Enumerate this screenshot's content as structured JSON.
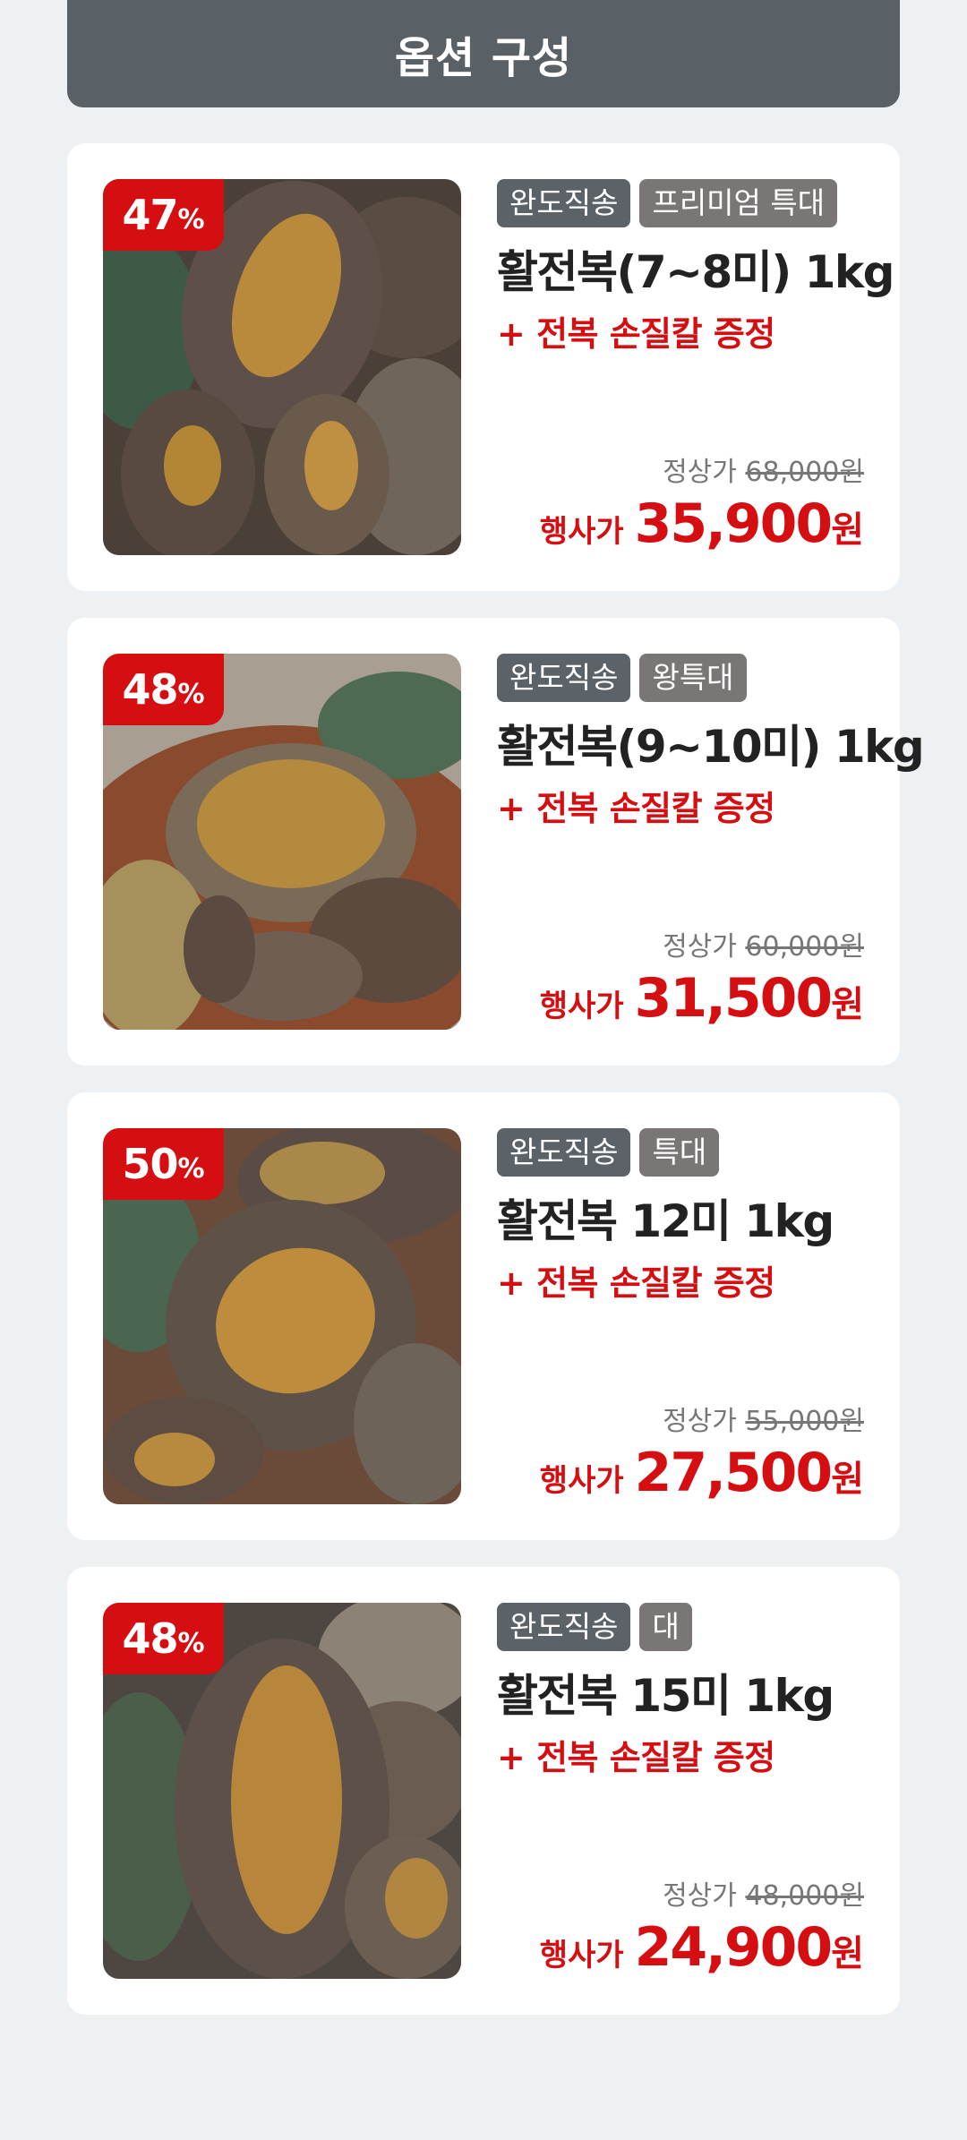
{
  "header": {
    "title": "옵션 구성"
  },
  "products": [
    {
      "discount": "47",
      "discount_unit": "%",
      "tag_origin": "완도직송",
      "tag_grade": "프리미엄 특대",
      "name": "활전복(7~8미) 1kg",
      "gift": "+ 전복 손질칼 증정",
      "orig_label": "정상가",
      "orig_price": "68,000원",
      "sale_label": "행사가",
      "sale_price": "35,900",
      "sale_unit": "원"
    },
    {
      "discount": "48",
      "discount_unit": "%",
      "tag_origin": "완도직송",
      "tag_grade": "왕특대",
      "name": "활전복(9~10미) 1kg",
      "gift": "+ 전복 손질칼 증정",
      "orig_label": "정상가",
      "orig_price": "60,000원",
      "sale_label": "행사가",
      "sale_price": "31,500",
      "sale_unit": "원"
    },
    {
      "discount": "50",
      "discount_unit": "%",
      "tag_origin": "완도직송",
      "tag_grade": "특대",
      "name": "활전복 12미 1kg",
      "gift": "+ 전복 손질칼 증정",
      "orig_label": "정상가",
      "orig_price": "55,000원",
      "sale_label": "행사가",
      "sale_price": "27,500",
      "sale_unit": "원"
    },
    {
      "discount": "48",
      "discount_unit": "%",
      "tag_origin": "완도직송",
      "tag_grade": "대",
      "name": "활전복 15미 1kg",
      "gift": "+ 전복 손질칼 증정",
      "orig_label": "정상가",
      "orig_price": "48,000원",
      "sale_label": "행사가",
      "sale_price": "24,900",
      "sale_unit": "원"
    }
  ],
  "colors": {
    "accent": "#d50e12",
    "header_bg": "#596066",
    "page_bg": "#eef1f4",
    "tag_origin_bg": "#5b6268",
    "tag_grade_bg": "#7b7676"
  }
}
